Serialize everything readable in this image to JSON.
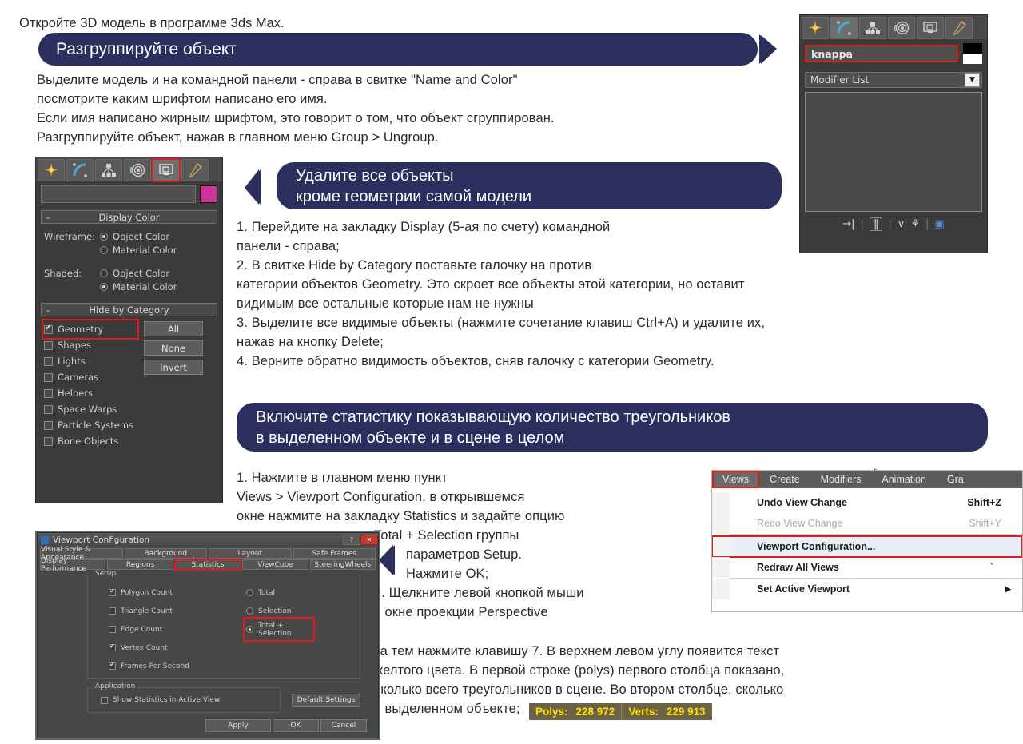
{
  "intro": {
    "line": "Откройте 3D модель в программе 3ds Max."
  },
  "banners": {
    "ungroup": "Разгруппируйте объект",
    "delete_all": "Удалите все объекты\nкроме геометрии самой модели",
    "statistics": "Включите статистику показывающую количество треугольников\nв выделенном объекте и в сцене в целом"
  },
  "paragraphs": {
    "ungroup_body": "Выделите модель и на командной панели - справа в свитке \"Name and Color\"\nпосмотрите каким шрифтом написано его имя.\nЕсли имя написано жирным шрифтом, это говорит о том, что объект сгруппирован.\nРазгруппируйте объект, нажав в главном меню Group > Ungroup.",
    "delete_steps": "1. Перейдите на закладку Display (5-ая по счету) командной\nпанели - справа;\n2. В свитке Hide by Category поставьте галочку на против\nкатегории объектов Geometry. Это скроет все объекты этой категории, но оставит\nвидимым все остальные которые нам не нужны\n3.  Выделите все видимые объекты (нажмите сочетание клавиш Ctrl+A) и удалите их,\nнажав на кнопку Delete;\n4.  Верните обратно видимость объектов, сняв галочку с категории Geometry.",
    "stats_step1": "1.  Нажмите в главном меню пункт\nViews > Viewport Configuration, в открывшемся\nокне нажмите на закладку Statistics и задайте опцию",
    "stats_step1b": "Total + Selection группы",
    "stats_step1c": "параметров Setup.",
    "stats_step1d": "Нажмите OK;",
    "stats_step2": "2.  Щелкните левой кнопкой мыши\nв окне проекции Perspective",
    "stats_tail": "за тем нажмите клавишу 7. В верхнем левом углу появится текст\nжелтого цвета. В первой строке (polys) первого столбца показано,\nсколько всего треугольников в сцене. Во втором столбце, сколько",
    "stats_tail_last": "в выделенном объекте;"
  },
  "right_panel": {
    "tabs": [
      {
        "name": "create-tab",
        "glyph": "☀",
        "selected": false
      },
      {
        "name": "modify-tab",
        "glyph": "◜",
        "selected": true
      },
      {
        "name": "hierarchy-tab",
        "glyph": "⚓",
        "selected": false
      },
      {
        "name": "motion-tab",
        "glyph": "◎",
        "selected": false
      },
      {
        "name": "display-tab",
        "glyph": "❐",
        "selected": false
      },
      {
        "name": "utilities-tab",
        "glyph": "⚒",
        "selected": false
      }
    ],
    "object_name": "knappa",
    "modifier_list_label": "Modifier List",
    "swatch_top": "#000000",
    "swatch_bottom": "#ffffff",
    "highlight_color": "#e01b1b"
  },
  "left_panel": {
    "tabs": [
      {
        "name": "create-tab",
        "glyph": "☀",
        "selected": false
      },
      {
        "name": "modify-tab",
        "glyph": "◜",
        "selected": false
      },
      {
        "name": "hierarchy-tab",
        "glyph": "⚓",
        "selected": false
      },
      {
        "name": "motion-tab",
        "glyph": "◎",
        "selected": false
      },
      {
        "name": "display-tab",
        "glyph": "❐",
        "selected": true
      },
      {
        "name": "utilities-tab",
        "glyph": "⚒",
        "selected": false
      }
    ],
    "object_name": "",
    "swatch_color": "#cc3399",
    "display_color": {
      "title": "Display Color",
      "wireframe_label": "Wireframe:",
      "shaded_label": "Shaded:",
      "wireframe_options": [
        {
          "label": "Object Color",
          "selected": true
        },
        {
          "label": "Material Color",
          "selected": false
        }
      ],
      "shaded_options": [
        {
          "label": "Object Color",
          "selected": false
        },
        {
          "label": "Material Color",
          "selected": true
        }
      ]
    },
    "hide_by_category": {
      "title": "Hide by Category",
      "categories": [
        {
          "label": "Geometry",
          "checked": true,
          "highlighted": true
        },
        {
          "label": "Shapes",
          "checked": false,
          "highlighted": false
        },
        {
          "label": "Lights",
          "checked": false,
          "highlighted": false
        },
        {
          "label": "Cameras",
          "checked": false,
          "highlighted": false
        },
        {
          "label": "Helpers",
          "checked": false,
          "highlighted": false
        },
        {
          "label": "Space Warps",
          "checked": false,
          "highlighted": false
        },
        {
          "label": "Particle Systems",
          "checked": false,
          "highlighted": false
        },
        {
          "label": "Bone Objects",
          "checked": false,
          "highlighted": false
        }
      ],
      "buttons": [
        "All",
        "None",
        "Invert"
      ]
    }
  },
  "views_menu": {
    "menubar": [
      {
        "label": "Views",
        "selected": true
      },
      {
        "label": "Create",
        "selected": false
      },
      {
        "label": "Modifiers",
        "selected": false
      },
      {
        "label": "Animation",
        "selected": false
      },
      {
        "label": "Gra",
        "selected": false
      }
    ],
    "items": [
      {
        "label": "Undo View Change",
        "shortcut": "Shift+Z",
        "disabled": false,
        "bold": true,
        "highlighted": false
      },
      {
        "label": "Redo View Change",
        "shortcut": "Shift+Y",
        "disabled": true,
        "bold": false,
        "highlighted": false
      },
      {
        "label": "Viewport Configuration...",
        "shortcut": "",
        "disabled": false,
        "bold": true,
        "highlighted": true
      },
      {
        "label": "Redraw All Views",
        "shortcut": "`",
        "disabled": false,
        "bold": true,
        "highlighted": false
      },
      {
        "label": "Set Active Viewport",
        "shortcut": "",
        "disabled": false,
        "bold": true,
        "highlighted": false,
        "submenu": true
      }
    ]
  },
  "viewport_dialog": {
    "title": "Viewport Configuration",
    "help_btn": "?",
    "close_btn": "✕",
    "tabs_row1": [
      "Visual Style & Appearance",
      "Background",
      "Layout",
      "Safe Frames"
    ],
    "tabs_row2": [
      "Display Performance",
      "Regions",
      "Statistics",
      "ViewCube",
      "SteeringWheels"
    ],
    "active_tab": "Statistics",
    "setup_group": "Setup",
    "checkboxes": [
      {
        "label": "Polygon Count",
        "checked": true
      },
      {
        "label": "Triangle Count",
        "checked": false
      },
      {
        "label": "Edge Count",
        "checked": false
      },
      {
        "label": "Vertex Count",
        "checked": true
      },
      {
        "label": "Frames Per Second",
        "checked": true
      }
    ],
    "radios": [
      {
        "label": "Total",
        "selected": false,
        "highlighted": false
      },
      {
        "label": "Selection",
        "selected": false,
        "highlighted": false
      },
      {
        "label": "Total + Selection",
        "selected": true,
        "highlighted": true
      }
    ],
    "application_group": "Application",
    "application_checkbox": {
      "label": "Show Statistics in Active View",
      "checked": false
    },
    "default_settings_btn": "Default Settings",
    "footer_buttons": [
      "Apply",
      "OK",
      "Cancel"
    ]
  },
  "stats_strip": {
    "polys_label": "Polys:",
    "polys_value": "228 972",
    "verts_label": "Verts:",
    "verts_value": "229 913",
    "bg_color": "#6b6248",
    "text_color": "#ffe000"
  },
  "theme": {
    "banner_navy": "#2b2f5e",
    "accent_red": "#e01b1b",
    "body_text": "#2a2a2a"
  }
}
